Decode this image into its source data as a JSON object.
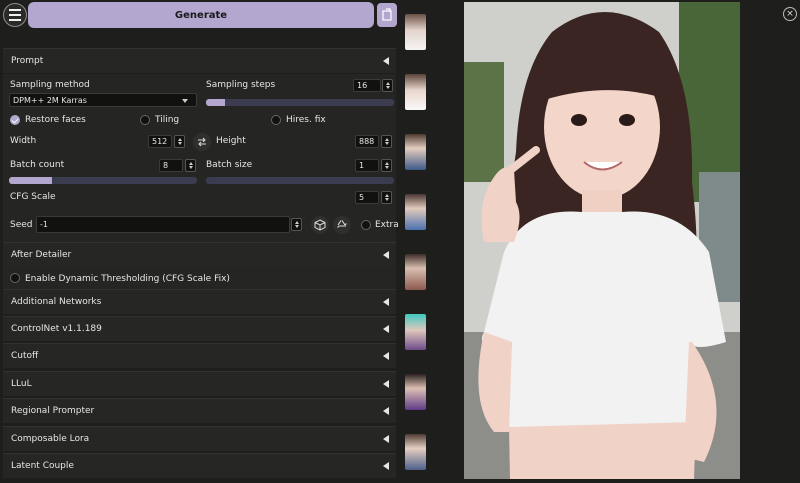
{
  "header": {
    "generate_label": "Generate"
  },
  "prompt": {
    "label": "Prompt"
  },
  "sampling": {
    "method_label": "Sampling method",
    "method_value": "DPM++ 2M Karras",
    "steps_label": "Sampling steps",
    "steps_value": "16",
    "steps_fraction": 0.1
  },
  "options": {
    "restore_faces_label": "Restore faces",
    "restore_faces_checked": true,
    "tiling_label": "Tiling",
    "hires_label": "Hires. fix"
  },
  "size": {
    "width_label": "Width",
    "width_value": "512",
    "height_label": "Height",
    "height_value": "888"
  },
  "batch": {
    "count_label": "Batch count",
    "count_value": "8",
    "count_fraction": 0.23,
    "size_label": "Batch size",
    "size_value": "1"
  },
  "cfg": {
    "label": "CFG Scale",
    "value": "5"
  },
  "seed": {
    "label": "Seed",
    "value": "-1",
    "extra_label": "Extra"
  },
  "accordions": {
    "after_detailer": "After Detailer",
    "dynamic_threshold": "Enable Dynamic Thresholding (CFG Scale Fix)",
    "additional_networks": "Additional Networks",
    "controlnet": "ControlNet v1.1.189",
    "cutoff": "Cutoff",
    "llul": "LLuL",
    "regional_prompter": "Regional Prompter",
    "composable_lora": "Composable Lora",
    "latent_couple": "Latent Couple"
  },
  "colors": {
    "accent": "#b3a6cf",
    "panel": "#252624",
    "background": "#1e1f1d"
  },
  "icons": {
    "menu": "menu-icon",
    "sync": "sync-icon",
    "swap": "swap-icon",
    "dice": "dice-icon",
    "recycle": "recycle-icon",
    "close": "close-icon",
    "collapse": "triangle-left-icon"
  }
}
